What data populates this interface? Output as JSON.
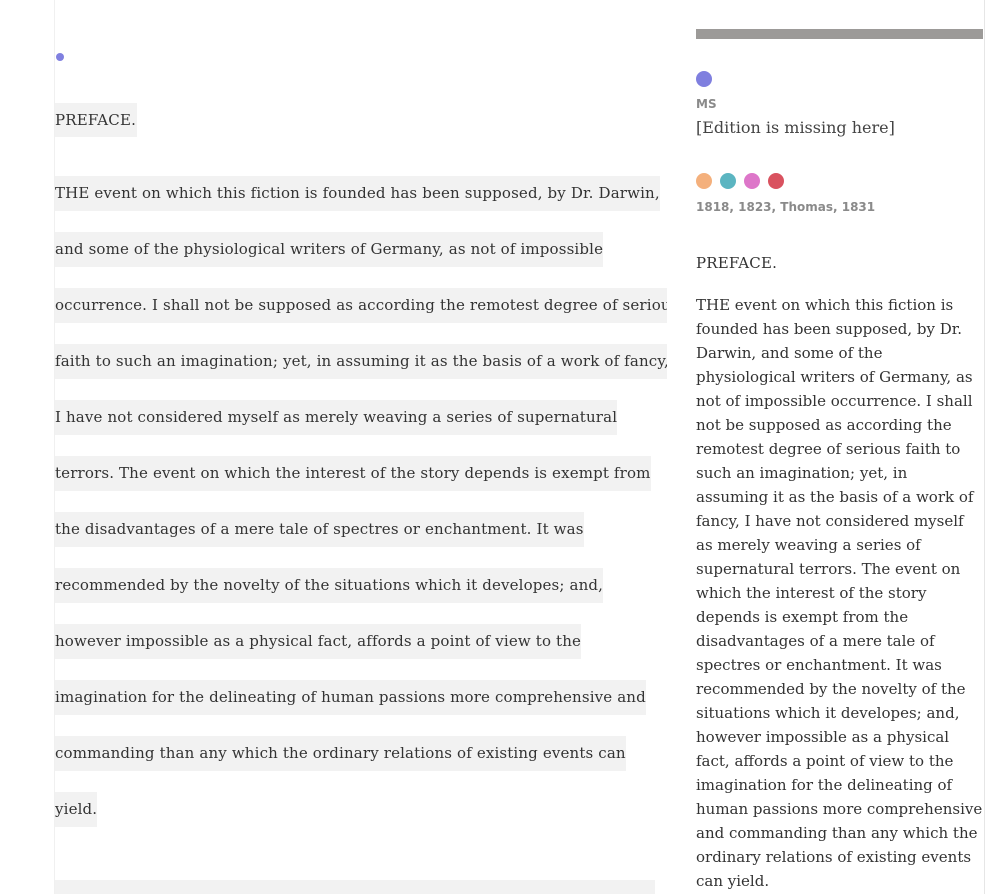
{
  "colors": {
    "line_highlight": "#f2f2f2",
    "left_dot": "#8080e0",
    "ms_dot": "#7f7fdf",
    "witness_bar": "#9c9a98"
  },
  "reading_pane": {
    "heading": "PREFACE.",
    "lines": [
      "THE event on which this fiction is founded has been supposed, by Dr. Darwin,",
      "and some of the physiological writers of Germany, as not of impossible",
      "occurrence. I shall not be supposed as according the remotest degree of serious",
      "faith to such an imagination; yet, in assuming it as the basis of a work of fancy,",
      "I have not considered myself as merely weaving a series of supernatural",
      "terrors. The event on which the interest of the story depends is exempt from",
      "the disadvantages of a mere tale of spectres or enchantment. It was",
      "recommended by the novelty of the situations which it developes; and,",
      "however impossible as a physical fact, affords a point of view to the",
      "imagination for the delineating of human passions more comprehensive and",
      "commanding than any which the ordinary relations of existing events can",
      "yield."
    ]
  },
  "variants_pane": {
    "ms": {
      "dot_color": "#7f7fdf",
      "label": "MS",
      "text": "[Edition is missing here]"
    },
    "editions": {
      "dot_colors": [
        "#f4b07c",
        "#5bb5c1",
        "#dd76c9",
        "#d9525f"
      ],
      "label": "1818, 1823, Thomas, 1831",
      "heading": "PREFACE.",
      "paragraph": "THE event on which this fiction is founded has been supposed, by Dr. Darwin, and some of the physiological writers of Germany, as not of impossible occurrence. I shall not be supposed as according the remotest degree of serious faith to such an imagination; yet, in assuming it as the basis of a work of fancy, I have not considered myself as merely weaving a series of supernatural terrors. The event on which the interest of the story depends is exempt from the disadvantages of a mere tale of spectres or enchantment. It was recommended by the novelty of the situations which it developes; and, however impossible as a physical fact, affords a point of view to the imagination for the delineating of human passions more comprehensive and commanding than any which the ordinary relations of existing events can yield."
    }
  }
}
